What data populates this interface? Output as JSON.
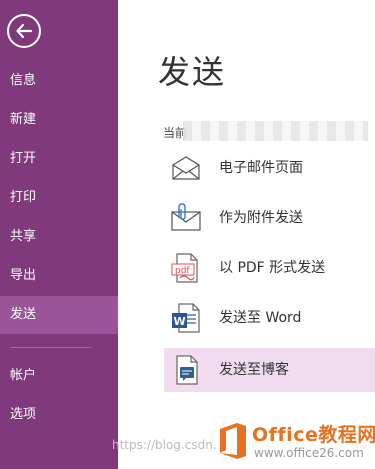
{
  "sidebar": {
    "items": [
      {
        "label": "信息"
      },
      {
        "label": "新建"
      },
      {
        "label": "打开"
      },
      {
        "label": "打印"
      },
      {
        "label": "共享"
      },
      {
        "label": "导出"
      },
      {
        "label": "发送",
        "active": true
      },
      {
        "label": "帐户"
      },
      {
        "label": "选项"
      }
    ],
    "accent_color": "#80397b",
    "active_color": "#9a5498"
  },
  "main": {
    "title": "发送",
    "current_label": "当前",
    "options": [
      {
        "label": "电子邮件页面",
        "icon": "envelope-icon"
      },
      {
        "label": "作为附件发送",
        "icon": "attachment-envelope-icon"
      },
      {
        "label": "以 PDF 形式发送",
        "icon": "pdf-document-icon"
      },
      {
        "label": "发送至 Word",
        "icon": "word-document-icon"
      },
      {
        "label": "发送至博客",
        "icon": "blog-document-icon",
        "highlighted": true
      }
    ]
  },
  "watermark": {
    "text": "https://blog.csdn.",
    "brand_name": "Office教程网",
    "brand_url": "www.office26.com"
  }
}
